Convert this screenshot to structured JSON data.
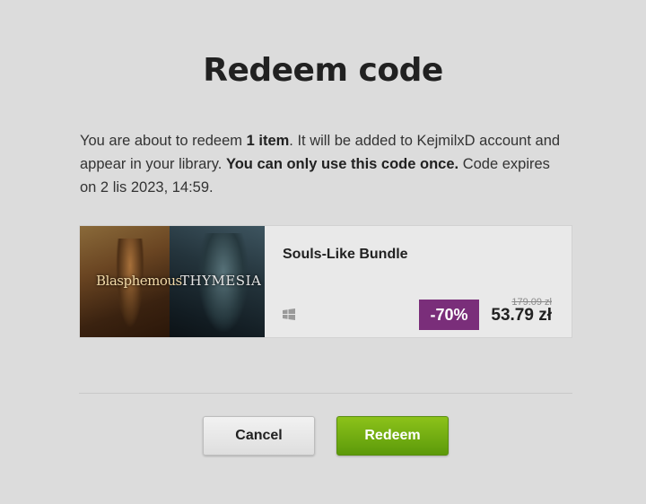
{
  "dialog": {
    "title": "Redeem code",
    "description": {
      "part1": "You are about to redeem ",
      "item_count": "1 item",
      "part2": ". It will be added to KejmilxD account and appear in your library. ",
      "warning": "You can only use this code once.",
      "part3": " Code expires on 2 lis 2023, 14:59."
    }
  },
  "product": {
    "name": "Souls-Like Bundle",
    "cover_text_left": "Blasphemous",
    "cover_text_right": "THYMESIA",
    "platform_icon": "windows-icon",
    "discount": "-70%",
    "old_price": "179.09 zł",
    "new_price": "53.79 zł"
  },
  "actions": {
    "cancel_label": "Cancel",
    "redeem_label": "Redeem"
  },
  "colors": {
    "discount_bg": "#7a2e7a",
    "redeem_green": "#73ae12",
    "background": "#dcdcdc"
  }
}
